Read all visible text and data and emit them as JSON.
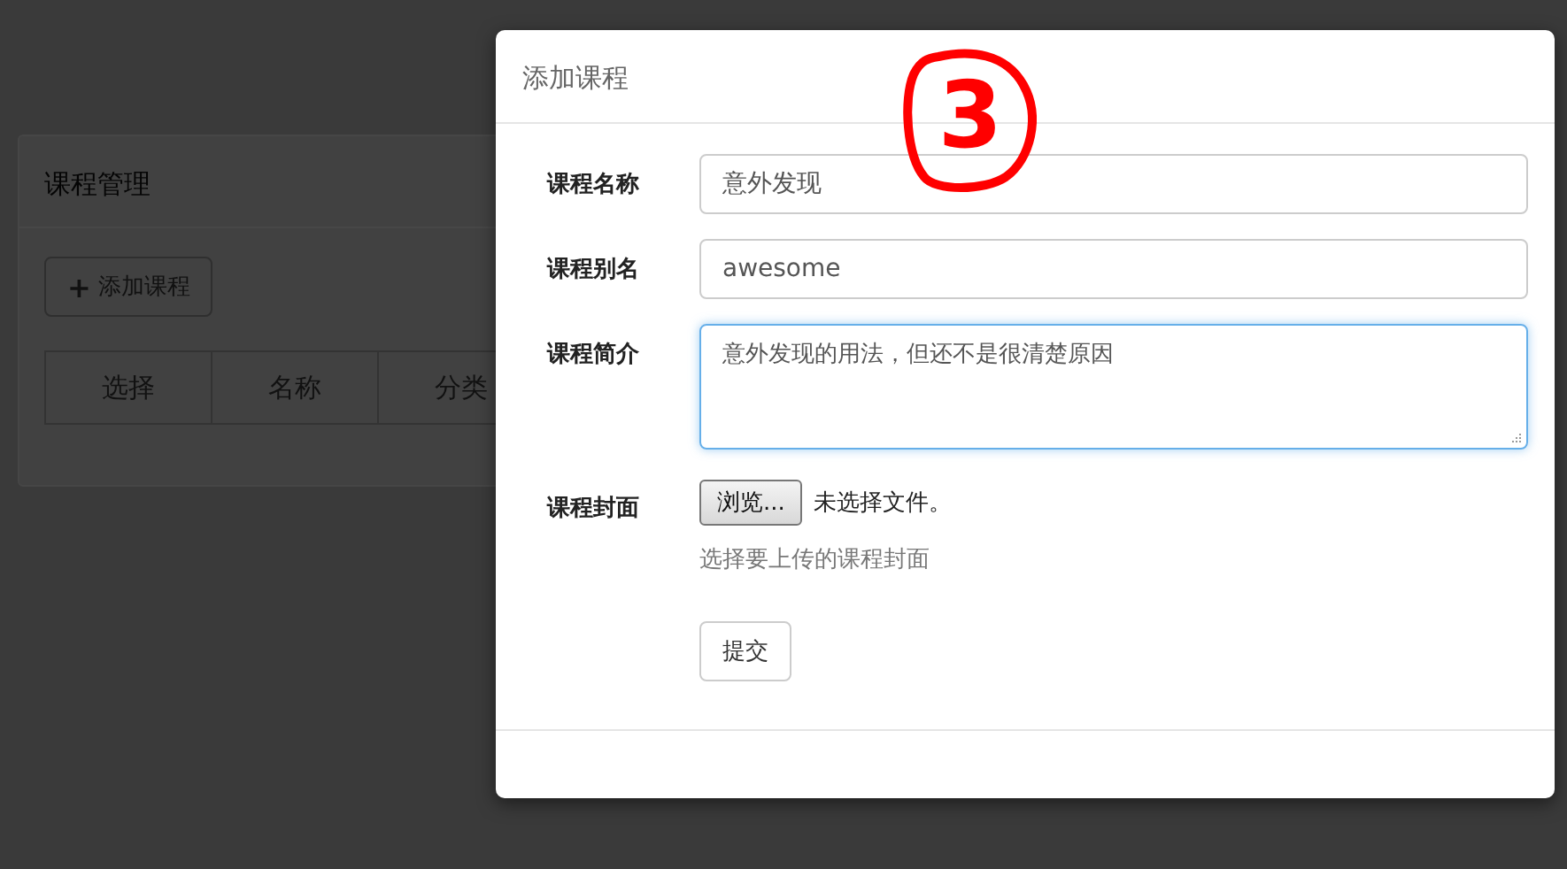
{
  "background_panel": {
    "title": "课程管理",
    "add_button": {
      "icon": "+",
      "label": "添加课程"
    },
    "table": {
      "columns": [
        "选择",
        "名称",
        "分类"
      ]
    }
  },
  "modal": {
    "title": "添加课程",
    "annotation": "3",
    "fields": [
      {
        "kind": "input",
        "label": "课程名称",
        "value": "意外发现",
        "focused": false
      },
      {
        "kind": "input",
        "label": "课程别名",
        "value": "awesome",
        "focused": false
      },
      {
        "kind": "textarea",
        "label": "课程简介",
        "value": "意外发现的用法，但还不是很清楚原因",
        "focused": true
      },
      {
        "kind": "file",
        "label": "课程封面",
        "button": "浏览...",
        "status": "未选择文件。",
        "help": "选择要上传的课程封面"
      }
    ],
    "submit": "提交"
  }
}
